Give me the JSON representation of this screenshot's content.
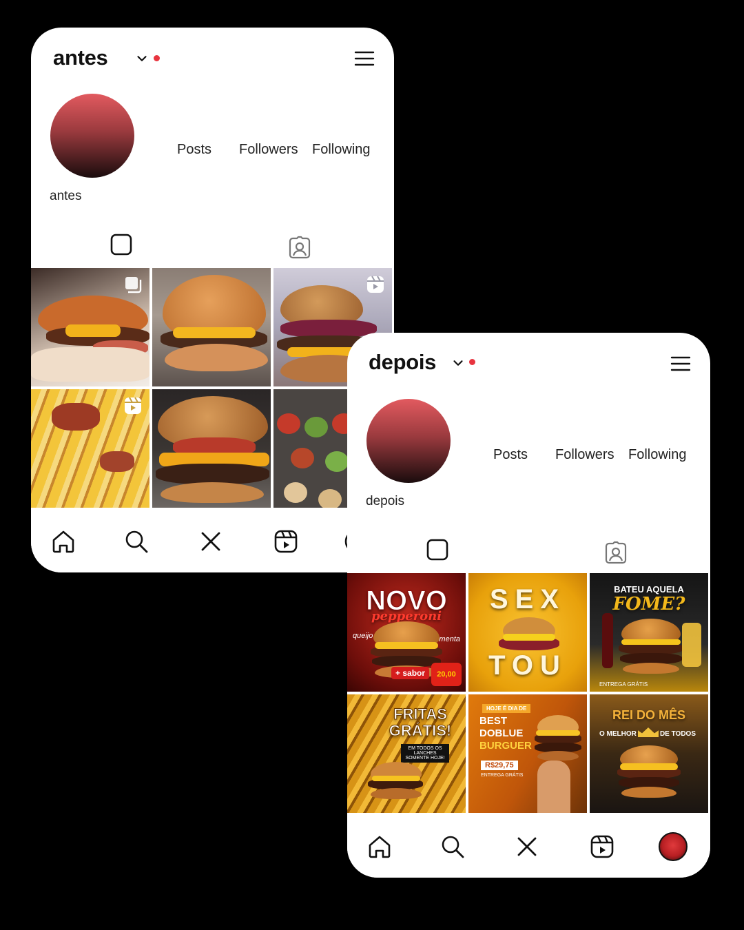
{
  "before": {
    "username": "antes",
    "profile_name": "antes",
    "stats": {
      "posts": "Posts",
      "followers": "Followers",
      "following": "Following"
    },
    "accent": "#e8343f",
    "grid": [
      {
        "icon": "multi-post-icon"
      },
      {
        "icon": ""
      },
      {
        "icon": "reels-icon"
      },
      {
        "icon": "reels-icon"
      },
      {
        "icon": ""
      },
      {
        "icon": ""
      }
    ]
  },
  "after": {
    "username": "depois",
    "profile_name": "depois",
    "stats": {
      "posts": "Posts",
      "followers": "Followers",
      "following": "Following"
    },
    "accent": "#e8343f",
    "posts": [
      {
        "headline": "NOVO",
        "script": "pepperoni",
        "tags": [
          "queijo",
          "pimenta"
        ],
        "badge": "+ sabor",
        "promo": "20,00"
      },
      {
        "headline": "SEX",
        "headline2": "TOU"
      },
      {
        "headline": "BATEU AQUELA",
        "script": "FOME?",
        "footer": "ENTREGA GRÁTIS"
      },
      {
        "headline": "FRITAS",
        "headline2": "GRÁTIS!",
        "sub": "EM TODOS OS LANCHES SOMENTE HOJE!"
      },
      {
        "tag": "HOJE É DIA DE",
        "headline": "BEST",
        "headline2": "DOBLUE",
        "headline3": "BURGUER",
        "price": "R$29,75",
        "footer": "ENTREGA GRÁTIS"
      },
      {
        "headline": "REI DO MÊS",
        "left": "O MELHOR",
        "right": "DE TODOS"
      }
    ]
  },
  "nav": [
    "home-icon",
    "search-icon",
    "close-icon",
    "reels-icon",
    "profile-avatar"
  ]
}
